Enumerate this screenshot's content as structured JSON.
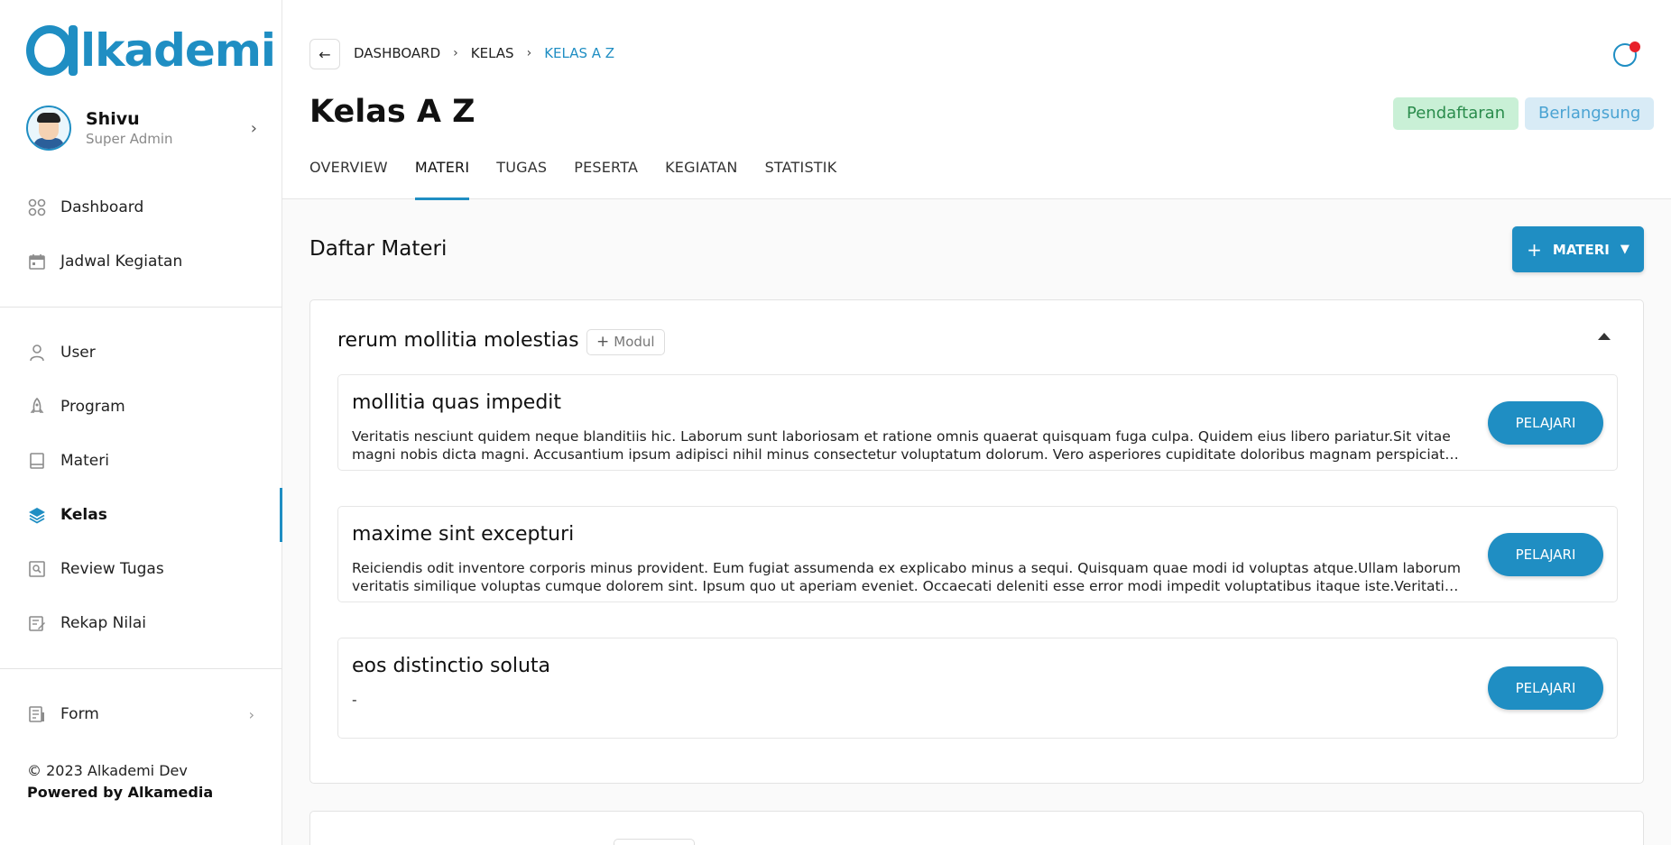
{
  "brand": {
    "logo_text": "lkademi",
    "color": "#1f8ec3"
  },
  "profile": {
    "name": "Shivu",
    "role": "Super Admin"
  },
  "sidebar": {
    "items": [
      {
        "label": "Dashboard",
        "icon": "dashboard-grid-icon"
      },
      {
        "label": "Jadwal Kegiatan",
        "icon": "calendar-icon"
      },
      {
        "label": "User",
        "icon": "user-icon"
      },
      {
        "label": "Program",
        "icon": "rocket-icon"
      },
      {
        "label": "Materi",
        "icon": "book-icon"
      },
      {
        "label": "Kelas",
        "icon": "layers-icon",
        "active": true
      },
      {
        "label": "Review Tugas",
        "icon": "review-icon"
      },
      {
        "label": "Rekap Nilai",
        "icon": "edit-note-icon"
      },
      {
        "label": "Form",
        "icon": "form-icon"
      }
    ]
  },
  "footer": {
    "copyright": "© 2023 Alkademi Dev",
    "powered": "Powered by Alkamedia"
  },
  "breadcrumb": [
    "DASHBOARD",
    "KELAS",
    "KELAS A Z"
  ],
  "page": {
    "title": "Kelas A Z",
    "badges": {
      "pendaftaran": "Pendaftaran",
      "berlangsung": "Berlangsung"
    },
    "tabs": [
      "OVERVIEW",
      "MATERI",
      "TUGAS",
      "PESERTA",
      "KEGIATAN",
      "STATISTIK"
    ],
    "active_tab": "MATERI"
  },
  "main": {
    "title": "Daftar Materi",
    "add_button": "MATERI",
    "modules": [
      {
        "title": "rerum mollitia molestias",
        "modul_button": "Modul",
        "lessons": [
          {
            "title": "mollitia quas impedit",
            "description": "Veritatis nesciunt quidem neque blanditiis hic. Laborum sunt laboriosam et ratione omnis quaerat quisquam fuga culpa. Quidem eius libero pariatur.Sit vitae magni nobis dicta magni. Accusantium ipsum adipisci nihil minus consectetur voluptatum dolorum. Vero asperiores cupiditate doloribus magnam perspiciatis quos quasi.",
            "button": "PELAJARI"
          },
          {
            "title": "maxime sint excepturi",
            "description": "Reiciendis odit inventore corporis minus provident. Eum fugiat assumenda ex explicabo minus a sequi. Quisquam quae modi id voluptas atque.Ullam laborum veritatis similique voluptas cumque dolorem sint. Ipsum quo ut aperiam eveniet. Occaecati deleniti esse error modi impedit voluptatibus itaque iste.Veritatis ullam.",
            "button": "PELAJARI"
          },
          {
            "title": "eos distinctio soluta",
            "description": "-",
            "button": "PELAJARI"
          }
        ]
      }
    ]
  }
}
